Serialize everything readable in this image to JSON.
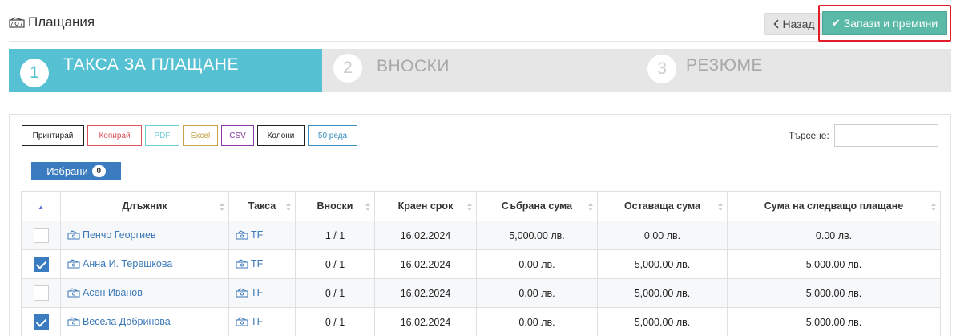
{
  "header": {
    "title": "Плащания",
    "back_label": "Назад",
    "save_label": "Запази и премини"
  },
  "wizard": {
    "steps": [
      {
        "num": "1",
        "label": "ТАКСА ЗА ПЛАЩАНЕ"
      },
      {
        "num": "2",
        "label": "ВНОСКИ"
      },
      {
        "num": "3",
        "label": "РЕЗЮМЕ"
      }
    ]
  },
  "toolbar": {
    "print": "Принтирай",
    "copy": "Копирай",
    "pdf": "PDF",
    "excel": "Excel",
    "csv": "CSV",
    "columns": "Колони",
    "rows": "50 реда",
    "search_label": "Търсене:",
    "search_value": "",
    "selected_label": "Избрани",
    "selected_count": "0"
  },
  "table": {
    "columns": [
      "Длъжник",
      "Такса",
      "Вноски",
      "Краен срок",
      "Събрана сума",
      "Оставаща сума",
      "Сума на следващо плащане"
    ],
    "rows": [
      {
        "checked": false,
        "debtor": "Пенчо Георгиев",
        "fee": "TF",
        "installments": "1 / 1",
        "due": "16.02.2024",
        "collected": "5,000.00 лв.",
        "remaining": "0.00 лв.",
        "next": "0.00 лв."
      },
      {
        "checked": true,
        "debtor": "Анна И. Терешкова",
        "fee": "TF",
        "installments": "0 / 1",
        "due": "16.02.2024",
        "collected": "0.00 лв.",
        "remaining": "5,000.00 лв.",
        "next": "5,000.00 лв."
      },
      {
        "checked": false,
        "debtor": "Асен Иванов",
        "fee": "TF",
        "installments": "0 / 1",
        "due": "16.02.2024",
        "collected": "0.00 лв.",
        "remaining": "5,000.00 лв.",
        "next": "5,000.00 лв."
      },
      {
        "checked": true,
        "debtor": "Весела Добринова",
        "fee": "TF",
        "installments": "0 / 1",
        "due": "16.02.2024",
        "collected": "0.00 лв.",
        "remaining": "5,000.00 лв.",
        "next": "5,000.00 лв."
      }
    ]
  },
  "colors": {
    "accent": "#55c1d3",
    "save": "#5bb9a8",
    "highlight": "#e11d2c",
    "link": "#3b79b8"
  }
}
